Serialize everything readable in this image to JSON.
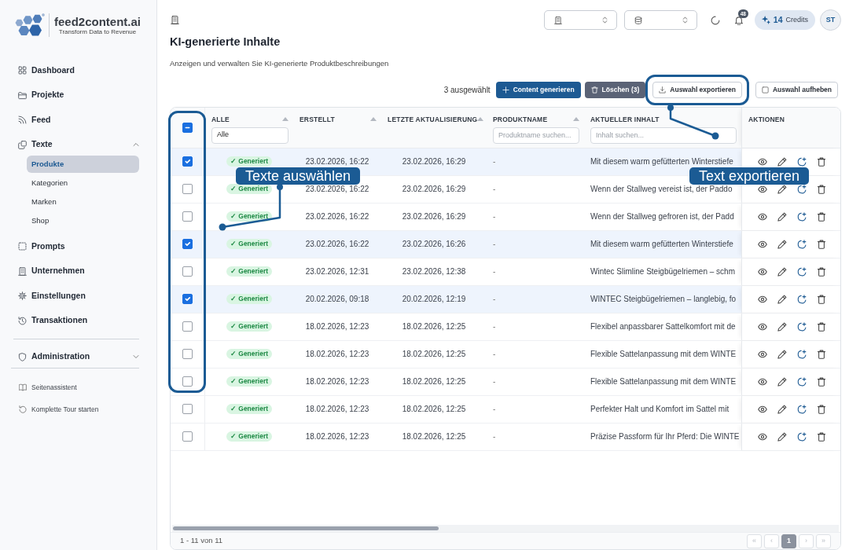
{
  "sidebar": {
    "logo": {
      "name": "feed2content.ai",
      "tagline": "Transform Data to Revenue"
    },
    "items": [
      {
        "label": "Dashboard"
      },
      {
        "label": "Projekte"
      },
      {
        "label": "Feed"
      },
      {
        "label": "Texte",
        "expanded": true,
        "children": [
          {
            "label": "Produkte",
            "selected": true
          },
          {
            "label": "Kategorien",
            "selected": false
          },
          {
            "label": "Marken",
            "selected": false
          },
          {
            "label": "Shop",
            "selected": false
          }
        ]
      },
      {
        "label": "Prompts"
      },
      {
        "label": "Unternehmen"
      },
      {
        "label": "Einstellungen"
      },
      {
        "label": "Transaktionen"
      }
    ],
    "admin": {
      "label": "Administration",
      "expanded": false
    },
    "help_links": [
      {
        "label": "Seitenassistent"
      },
      {
        "label": "Komplette Tour starten"
      }
    ]
  },
  "topbar": {
    "notifications": "48",
    "credits": {
      "amount": "14",
      "label": "Credits"
    },
    "user_initials": "ST"
  },
  "page": {
    "title": "KI-generierte Inhalte",
    "subtitle": "Anzeigen und verwalten Sie KI-generierte Produktbeschreibungen"
  },
  "toolbar": {
    "selection_count": "3 ausgewählt",
    "buttons": [
      {
        "label": "Content generieren",
        "kind": "primary"
      },
      {
        "label": "Löschen (3)",
        "kind": "secondary"
      },
      {
        "label": "Auswahl exportieren",
        "kind": "outline"
      },
      {
        "label": "Auswahl aufheben",
        "kind": "outline"
      }
    ]
  },
  "table": {
    "select_all": {
      "indeterminate": true
    },
    "columns": [
      {
        "label": "ALLE",
        "sortable": true,
        "filter": {
          "kind": "select",
          "value": "Alle"
        }
      },
      {
        "label": "ERSTELLT",
        "sortable": true
      },
      {
        "label": "LETZTE AKTUALISIERUNG",
        "sortable": true
      },
      {
        "label": "PRODUKTNAME",
        "sortable": true,
        "filter": {
          "kind": "text",
          "placeholder": "Produktname suchen..."
        }
      },
      {
        "label": "AKTUELLER INHALT",
        "sortable": false,
        "filter": {
          "kind": "text",
          "placeholder": "Inhalt suchen..."
        }
      },
      {
        "label": "AKTIONEN",
        "sortable": false
      }
    ],
    "rows": [
      {
        "selected": true,
        "status": "✓ Generiert",
        "created": "23.02.2026, 16:22",
        "updated": "23.02.2026, 16:29",
        "product": "-",
        "content": "Mit diesem warm gefütterten Winterstiefe"
      },
      {
        "selected": false,
        "status": "✓ Generiert",
        "created": "23.02.2026, 16:22",
        "updated": "23.02.2026, 16:29",
        "product": "-",
        "content": "Wenn der Stallweg vereist ist, der Paddo"
      },
      {
        "selected": false,
        "status": "✓ Generiert",
        "created": "23.02.2026, 16:22",
        "updated": "23.02.2026, 16:29",
        "product": "-",
        "content": "Wenn der Stallweg gefroren ist, der Padd"
      },
      {
        "selected": true,
        "status": "✓ Generiert",
        "created": "23.02.2026, 16:22",
        "updated": "23.02.2026, 16:26",
        "product": "-",
        "content": "Mit diesem warm gefütterten Winterstiefe"
      },
      {
        "selected": false,
        "status": "✓ Generiert",
        "created": "23.02.2026, 12:31",
        "updated": "23.02.2026, 12:38",
        "product": "-",
        "content": "Wintec Slimline Steigbügelriemen – schm"
      },
      {
        "selected": true,
        "status": "✓ Generiert",
        "created": "20.02.2026, 09:18",
        "updated": "20.02.2026, 12:19",
        "product": "-",
        "content": "WINTEC Steigbügelriemen – langlebig, fo"
      },
      {
        "selected": false,
        "status": "✓ Generiert",
        "created": "18.02.2026, 12:23",
        "updated": "18.02.2026, 12:25",
        "product": "-",
        "content": "Flexibel anpassbarer Sattelkomfort mit de"
      },
      {
        "selected": false,
        "status": "✓ Generiert",
        "created": "18.02.2026, 12:23",
        "updated": "18.02.2026, 12:25",
        "product": "-",
        "content": "Flexible Sattelanpassung mit dem WINTE"
      },
      {
        "selected": false,
        "status": "✓ Generiert",
        "created": "18.02.2026, 12:23",
        "updated": "18.02.2026, 12:25",
        "product": "-",
        "content": "Flexible Sattelanpassung mit dem WINTE"
      },
      {
        "selected": false,
        "status": "✓ Generiert",
        "created": "18.02.2026, 12:23",
        "updated": "18.02.2026, 12:25",
        "product": "-",
        "content": "Perfekter Halt und Komfort im Sattel mit"
      },
      {
        "selected": false,
        "status": "✓ Generiert",
        "created": "18.02.2026, 12:23",
        "updated": "18.02.2026, 12:25",
        "product": "-",
        "content": "Präzise Passform für Ihr Pferd: Die WINTE"
      }
    ],
    "range": "1 - 11 von 11",
    "pagination": [
      {
        "label": "«",
        "selected": false,
        "disabled": true
      },
      {
        "label": "‹",
        "selected": false,
        "disabled": true
      },
      {
        "label": "1",
        "selected": true,
        "disabled": false
      },
      {
        "label": "›",
        "selected": false,
        "disabled": true
      },
      {
        "label": "»",
        "selected": false,
        "disabled": true
      }
    ]
  },
  "annotations": [
    {
      "text": "Texte auswählen"
    },
    {
      "text": "Text exportieren"
    }
  ]
}
